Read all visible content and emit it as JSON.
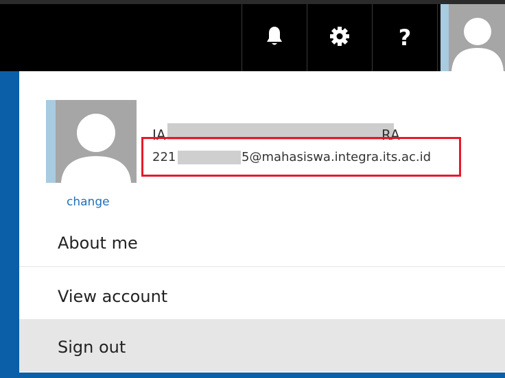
{
  "topbar": {
    "icons": [
      "bell-icon",
      "gear-icon",
      "help-icon"
    ],
    "help_glyph": "?",
    "avatar": "user-avatar-icon"
  },
  "profile": {
    "name_start": "IA",
    "name_end": "RA",
    "email_prefix": "221",
    "email_suffix": "5@mahasiswa.integra.its.ac.id",
    "change_label": "change"
  },
  "menu": {
    "items": [
      {
        "label": "About me"
      },
      {
        "label": "View account"
      },
      {
        "label": "Sign out"
      }
    ]
  },
  "colors": {
    "accent_blue": "#0b5ea8",
    "highlight_red": "#e5192b",
    "link_blue": "#1f6fba",
    "hover_gray": "#e6e6e6"
  }
}
